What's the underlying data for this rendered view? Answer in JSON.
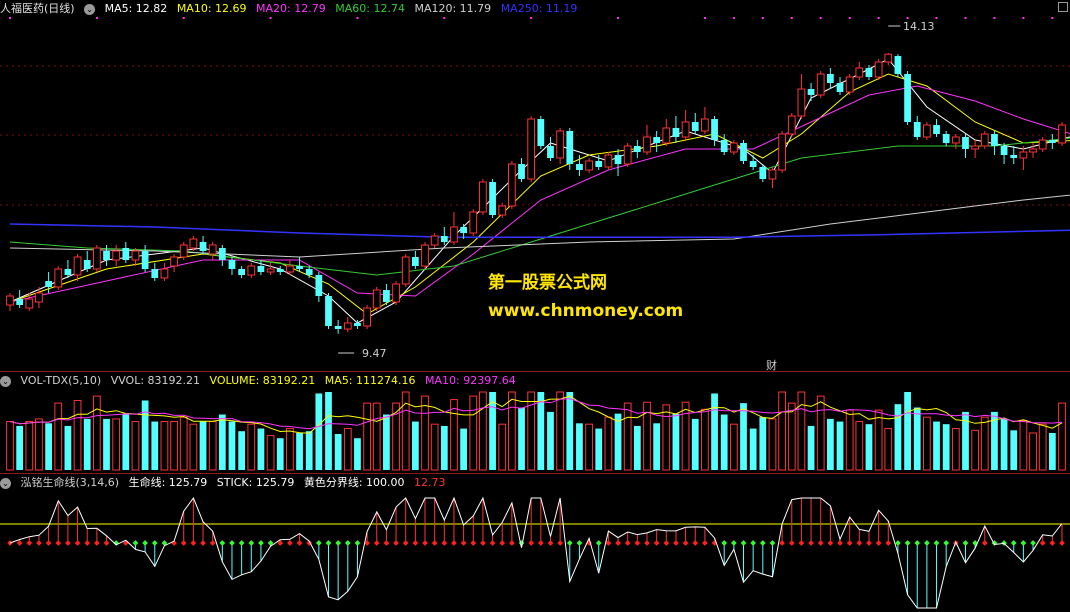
{
  "main": {
    "title": "人福医药(日线)",
    "ma": [
      {
        "label": "MA5: 12.82",
        "color": "#ffffff"
      },
      {
        "label": "MA10: 12.69",
        "color": "#ffff00"
      },
      {
        "label": "MA20: 12.79",
        "color": "#ff33ff"
      },
      {
        "label": "MA60: 12.74",
        "color": "#33cc33"
      },
      {
        "label": "MA120: 11.79",
        "color": "#d0d0d0"
      },
      {
        "label": "MA250: 11.19",
        "color": "#3333ff"
      }
    ],
    "high_label": "14.13",
    "low_label": "9.47",
    "fin_marker": "财"
  },
  "watermark": {
    "line1": "第一股票公式网",
    "line2": "www.chnmoney.com"
  },
  "vol": {
    "title": "VOL-TDX(5,10)",
    "vvol": "VVOL: 83192.21",
    "volume": "VOLUME: 83192.21",
    "ma5": "MA5: 111274.16",
    "ma10": "MA10: 92397.64"
  },
  "life": {
    "title": "泓铭生命线(3,14,6)",
    "life_line": "生命线: 125.79",
    "stick": "STICK: 125.79",
    "yellow": "黄色分界线: 100.00",
    "extra": "12.73"
  },
  "chart_data": {
    "type": "candlestick",
    "ylim": [
      9.0,
      14.6
    ],
    "candles": [
      [
        9.95,
        10.1,
        9.85,
        10.15
      ],
      [
        10.05,
        9.95,
        9.9,
        10.2
      ],
      [
        9.9,
        10.05,
        9.85,
        10.15
      ],
      [
        10.0,
        10.15,
        9.9,
        10.25
      ],
      [
        10.35,
        10.25,
        10.15,
        10.5
      ],
      [
        10.25,
        10.55,
        10.2,
        10.6
      ],
      [
        10.55,
        10.45,
        10.4,
        10.7
      ],
      [
        10.45,
        10.75,
        10.35,
        10.8
      ],
      [
        10.7,
        10.55,
        10.5,
        10.85
      ],
      [
        10.55,
        10.9,
        10.5,
        10.95
      ],
      [
        10.85,
        10.7,
        10.6,
        10.95
      ],
      [
        10.7,
        10.85,
        10.6,
        10.95
      ],
      [
        10.9,
        10.7,
        10.65,
        11.0
      ],
      [
        10.7,
        10.85,
        10.6,
        10.9
      ],
      [
        10.85,
        10.55,
        10.5,
        10.95
      ],
      [
        10.55,
        10.4,
        10.35,
        10.65
      ],
      [
        10.4,
        10.55,
        10.35,
        10.65
      ],
      [
        10.6,
        10.75,
        10.5,
        10.8
      ],
      [
        10.75,
        10.95,
        10.7,
        11.0
      ],
      [
        10.9,
        11.05,
        10.85,
        11.1
      ],
      [
        11.0,
        10.85,
        10.8,
        11.1
      ],
      [
        10.8,
        10.95,
        10.7,
        11.0
      ],
      [
        10.9,
        10.7,
        10.6,
        10.95
      ],
      [
        10.7,
        10.55,
        10.45,
        10.75
      ],
      [
        10.55,
        10.45,
        10.4,
        10.6
      ],
      [
        10.45,
        10.6,
        10.4,
        10.65
      ],
      [
        10.6,
        10.5,
        10.45,
        10.7
      ],
      [
        10.5,
        10.55,
        10.45,
        10.65
      ],
      [
        10.55,
        10.5,
        10.45,
        10.6
      ],
      [
        10.5,
        10.6,
        10.45,
        10.7
      ],
      [
        10.6,
        10.55,
        10.5,
        10.75
      ],
      [
        10.55,
        10.45,
        10.4,
        10.6
      ],
      [
        10.45,
        10.1,
        10.0,
        10.5
      ],
      [
        10.1,
        9.6,
        9.55,
        10.15
      ],
      [
        9.6,
        9.55,
        9.47,
        9.7
      ],
      [
        9.55,
        9.65,
        9.5,
        9.75
      ],
      [
        9.65,
        9.6,
        9.55,
        9.7
      ],
      [
        9.6,
        9.9,
        9.55,
        9.95
      ],
      [
        9.9,
        10.2,
        9.85,
        10.25
      ],
      [
        10.2,
        10.0,
        9.95,
        10.3
      ],
      [
        10.0,
        10.3,
        9.95,
        10.35
      ],
      [
        10.3,
        10.75,
        10.25,
        10.8
      ],
      [
        10.75,
        10.6,
        10.55,
        10.85
      ],
      [
        10.6,
        10.95,
        10.55,
        11.0
      ],
      [
        10.95,
        11.1,
        10.9,
        11.15
      ],
      [
        11.1,
        11.0,
        10.95,
        11.25
      ],
      [
        11.0,
        11.25,
        10.95,
        11.5
      ],
      [
        11.25,
        11.15,
        11.05,
        11.3
      ],
      [
        11.15,
        11.5,
        11.1,
        11.55
      ],
      [
        11.5,
        12.0,
        11.45,
        12.05
      ],
      [
        12.0,
        11.45,
        11.4,
        12.05
      ],
      [
        11.45,
        11.6,
        11.4,
        11.65
      ],
      [
        11.6,
        12.3,
        11.55,
        12.35
      ],
      [
        12.3,
        12.05,
        12.0,
        12.4
      ],
      [
        12.05,
        13.05,
        12.0,
        13.1
      ],
      [
        13.05,
        12.6,
        12.55,
        13.1
      ],
      [
        12.6,
        12.4,
        12.35,
        12.75
      ],
      [
        12.4,
        12.85,
        12.3,
        12.9
      ],
      [
        12.85,
        12.3,
        12.2,
        12.9
      ],
      [
        12.3,
        12.2,
        12.1,
        12.45
      ],
      [
        12.2,
        12.35,
        12.15,
        12.4
      ],
      [
        12.35,
        12.25,
        12.2,
        12.45
      ],
      [
        12.25,
        12.45,
        12.2,
        12.5
      ],
      [
        12.45,
        12.3,
        12.1,
        12.55
      ],
      [
        12.3,
        12.6,
        12.25,
        12.65
      ],
      [
        12.6,
        12.5,
        12.4,
        12.7
      ],
      [
        12.5,
        12.75,
        12.45,
        12.95
      ],
      [
        12.75,
        12.65,
        12.5,
        12.85
      ],
      [
        12.65,
        12.9,
        12.6,
        13.05
      ],
      [
        12.9,
        12.75,
        12.65,
        13.1
      ],
      [
        12.75,
        13.0,
        12.7,
        13.2
      ],
      [
        13.0,
        12.85,
        12.8,
        13.15
      ],
      [
        12.85,
        13.05,
        12.8,
        13.25
      ],
      [
        13.05,
        12.7,
        12.6,
        13.1
      ],
      [
        12.7,
        12.5,
        12.45,
        12.8
      ],
      [
        12.5,
        12.65,
        12.45,
        12.7
      ],
      [
        12.65,
        12.35,
        12.3,
        12.7
      ],
      [
        12.35,
        12.25,
        12.2,
        12.45
      ],
      [
        12.25,
        12.05,
        12.0,
        12.3
      ],
      [
        12.05,
        12.2,
        11.9,
        12.25
      ],
      [
        12.2,
        12.8,
        12.15,
        12.85
      ],
      [
        12.8,
        13.1,
        12.75,
        13.15
      ],
      [
        13.1,
        13.55,
        13.05,
        13.8
      ],
      [
        13.55,
        13.45,
        13.35,
        13.65
      ],
      [
        13.45,
        13.8,
        13.4,
        13.85
      ],
      [
        13.8,
        13.65,
        13.55,
        13.9
      ],
      [
        13.65,
        13.5,
        13.45,
        13.75
      ],
      [
        13.5,
        13.75,
        13.45,
        13.8
      ],
      [
        13.75,
        13.9,
        13.7,
        14.0
      ],
      [
        13.9,
        13.75,
        13.7,
        13.95
      ],
      [
        13.75,
        14.0,
        13.7,
        14.05
      ],
      [
        14.0,
        14.13,
        13.95,
        14.15
      ],
      [
        14.1,
        13.8,
        13.75,
        14.13
      ],
      [
        13.8,
        13.0,
        12.95,
        13.85
      ],
      [
        13.0,
        12.75,
        12.7,
        13.1
      ],
      [
        12.75,
        12.95,
        12.7,
        13.0
      ],
      [
        12.95,
        12.8,
        12.75,
        13.05
      ],
      [
        12.8,
        12.65,
        12.6,
        12.85
      ],
      [
        12.65,
        12.75,
        12.55,
        12.8
      ],
      [
        12.75,
        12.55,
        12.4,
        12.8
      ],
      [
        12.55,
        12.6,
        12.4,
        12.7
      ],
      [
        12.6,
        12.8,
        12.55,
        12.85
      ],
      [
        12.8,
        12.6,
        12.45,
        12.85
      ],
      [
        12.6,
        12.45,
        12.3,
        12.65
      ],
      [
        12.45,
        12.4,
        12.3,
        12.6
      ],
      [
        12.4,
        12.5,
        12.2,
        12.6
      ],
      [
        12.5,
        12.55,
        12.4,
        12.65
      ],
      [
        12.55,
        12.7,
        12.5,
        12.75
      ],
      [
        12.7,
        12.65,
        12.55,
        12.8
      ],
      [
        12.65,
        12.95,
        12.6,
        13.0
      ]
    ],
    "ma_series": [
      {
        "color": "#ffffff",
        "width": 1,
        "pts": [
          [
            0,
            10.0
          ],
          [
            10,
            10.7
          ],
          [
            20,
            10.9
          ],
          [
            28,
            10.55
          ],
          [
            33,
            10.1
          ],
          [
            36,
            9.65
          ],
          [
            40,
            10.0
          ],
          [
            46,
            11.1
          ],
          [
            53,
            12.2
          ],
          [
            56,
            12.65
          ],
          [
            62,
            12.35
          ],
          [
            70,
            12.85
          ],
          [
            76,
            12.55
          ],
          [
            79,
            12.15
          ],
          [
            83,
            13.4
          ],
          [
            88,
            13.8
          ],
          [
            91,
            14.05
          ],
          [
            95,
            13.25
          ],
          [
            100,
            12.7
          ],
          [
            105,
            12.55
          ],
          [
            111,
            12.8
          ]
        ]
      },
      {
        "color": "#ffff00",
        "width": 1,
        "pts": [
          [
            0,
            10.0
          ],
          [
            10,
            10.55
          ],
          [
            20,
            10.8
          ],
          [
            28,
            10.65
          ],
          [
            33,
            10.3
          ],
          [
            37,
            9.8
          ],
          [
            42,
            10.25
          ],
          [
            48,
            11.0
          ],
          [
            55,
            12.1
          ],
          [
            60,
            12.45
          ],
          [
            67,
            12.6
          ],
          [
            73,
            12.8
          ],
          [
            78,
            12.4
          ],
          [
            82,
            12.8
          ],
          [
            87,
            13.5
          ],
          [
            91,
            13.8
          ],
          [
            95,
            13.6
          ],
          [
            100,
            13.0
          ],
          [
            105,
            12.65
          ],
          [
            111,
            12.7
          ]
        ]
      },
      {
        "color": "#ff33ff",
        "width": 1,
        "pts": [
          [
            0,
            10.0
          ],
          [
            10,
            10.35
          ],
          [
            20,
            10.7
          ],
          [
            30,
            10.7
          ],
          [
            36,
            10.15
          ],
          [
            42,
            10.1
          ],
          [
            48,
            10.8
          ],
          [
            55,
            11.7
          ],
          [
            62,
            12.2
          ],
          [
            70,
            12.55
          ],
          [
            77,
            12.55
          ],
          [
            83,
            13.0
          ],
          [
            89,
            13.45
          ],
          [
            94,
            13.6
          ],
          [
            100,
            13.35
          ],
          [
            105,
            13.05
          ],
          [
            111,
            12.75
          ]
        ]
      },
      {
        "color": "#33cc33",
        "width": 1,
        "pts": [
          [
            0,
            11.0
          ],
          [
            8,
            10.9
          ],
          [
            18,
            10.85
          ],
          [
            30,
            10.6
          ],
          [
            38,
            10.45
          ],
          [
            46,
            10.6
          ],
          [
            54,
            11.0
          ],
          [
            62,
            11.4
          ],
          [
            72,
            11.9
          ],
          [
            82,
            12.4
          ],
          [
            92,
            12.6
          ],
          [
            102,
            12.6
          ],
          [
            111,
            12.75
          ]
        ]
      },
      {
        "color": "#d0d0d0",
        "width": 1,
        "pts": [
          [
            0,
            10.9
          ],
          [
            15,
            10.85
          ],
          [
            30,
            10.75
          ],
          [
            45,
            10.9
          ],
          [
            60,
            11.0
          ],
          [
            75,
            11.05
          ],
          [
            85,
            11.3
          ],
          [
            95,
            11.5
          ],
          [
            105,
            11.7
          ],
          [
            111,
            11.8
          ]
        ]
      },
      {
        "color": "#3333ff",
        "width": 1.5,
        "pts": [
          [
            0,
            11.3
          ],
          [
            15,
            11.25
          ],
          [
            30,
            11.15
          ],
          [
            45,
            11.08
          ],
          [
            60,
            11.08
          ],
          [
            75,
            11.08
          ],
          [
            90,
            11.12
          ],
          [
            111,
            11.2
          ]
        ]
      }
    ]
  }
}
